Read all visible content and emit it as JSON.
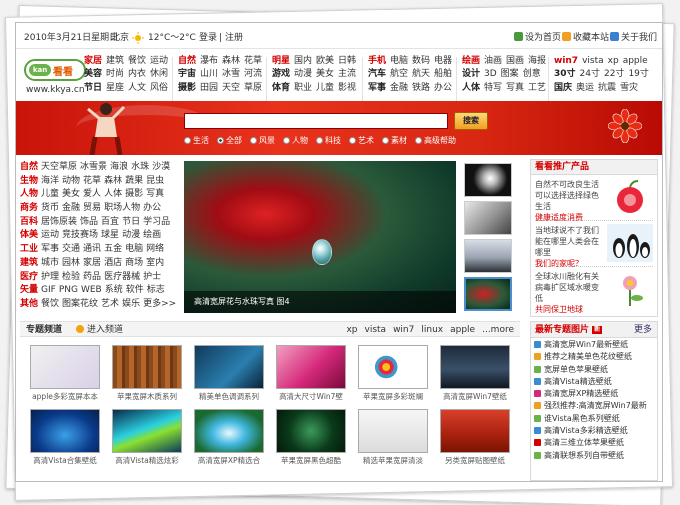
{
  "topbar": {
    "date": "2010年3月21日星期日",
    "city": "北京",
    "temperature": "12°C～2°C",
    "login": "登录",
    "divider": "|",
    "register": "注册",
    "set_home": "设为首页",
    "bookmark": "收藏本站",
    "about": "关于我们"
  },
  "logo": {
    "badge": "kan",
    "name": "看看",
    "url": "www.kkya.cn"
  },
  "nav_groups": [
    {
      "rows": [
        [
          "家居",
          "建筑",
          "餐饮",
          "运动"
        ],
        [
          "美容",
          "时尚",
          "内衣",
          "休闲"
        ],
        [
          "节日",
          "星座",
          "人文",
          "风俗"
        ]
      ]
    },
    {
      "rows": [
        [
          "自然",
          "瀑布",
          "森林",
          "花草"
        ],
        [
          "宇宙",
          "山川",
          "冰雪",
          "河流"
        ],
        [
          "摄影",
          "田园",
          "天空",
          "草原"
        ]
      ]
    },
    {
      "rows": [
        [
          "明星",
          "国内",
          "欧美",
          "日韩"
        ],
        [
          "游戏",
          "动漫",
          "美女",
          "主流"
        ],
        [
          "体育",
          "职业",
          "儿童",
          "影视"
        ]
      ]
    },
    {
      "rows": [
        [
          "手机",
          "电脑",
          "数码",
          "电器"
        ],
        [
          "汽车",
          "航空",
          "航天",
          "船舶"
        ],
        [
          "军事",
          "金融",
          "铁路",
          "办公"
        ]
      ]
    },
    {
      "rows": [
        [
          "绘画",
          "油画",
          "国画",
          "海报"
        ],
        [
          "设计",
          "3D",
          "图案",
          "创意"
        ],
        [
          "人体",
          "特写",
          "写真",
          "工艺"
        ]
      ]
    },
    {
      "rows": [
        [
          "win7",
          "vista",
          "xp",
          "apple"
        ],
        [
          "30寸",
          "24寸",
          "22寸",
          "19寸"
        ],
        [
          "国庆",
          "奥运",
          "抗震",
          "雪灾"
        ]
      ]
    }
  ],
  "search": {
    "button": "搜索",
    "options": [
      "生活",
      "全部",
      "风景",
      "人物",
      "科技",
      "艺术",
      "素材",
      "高级帮助"
    ],
    "selected": "全部"
  },
  "categories": [
    [
      "自然",
      "天空草原",
      "冰雪景",
      "海浪",
      "水珠",
      "沙漠"
    ],
    [
      "生物",
      "海洋",
      "动物",
      "花草",
      "森林",
      "蔬果",
      "昆虫"
    ],
    [
      "人物",
      "儿童",
      "美女",
      "爱人",
      "人体",
      "摄影",
      "写真"
    ],
    [
      "商务",
      "货币",
      "金融",
      "贸易",
      "职场人物",
      "办公"
    ],
    [
      "百科",
      "居饰原装",
      "饰品",
      "百宜",
      "节日",
      "学习品"
    ],
    [
      "体美",
      "运动",
      "竞技赛场",
      "球星",
      "动漫",
      "绘画"
    ],
    [
      "工业",
      "军事",
      "交通",
      "通讯",
      "五金",
      "电脑",
      "网络"
    ],
    [
      "建筑",
      "城市",
      "园林",
      "家居",
      "酒店",
      "商场",
      "室内"
    ],
    [
      "医疗",
      "护理",
      "检验",
      "药品",
      "医疗器械",
      "护士"
    ],
    [
      "矢量",
      "GIF",
      "PNG",
      "WEB",
      "系统",
      "软件",
      "标志"
    ],
    [
      "其他",
      "餐饮",
      "图案花纹",
      "艺术",
      "娱乐",
      "更多>>"
    ]
  ],
  "featured": {
    "caption": "高清宽屏花与水珠写真 图4"
  },
  "promo": {
    "title": "看看推广产品",
    "items": [
      {
        "text": "自然不可改良生活可以选择选择绿色生活",
        "highlight": "健康适度消费"
      },
      {
        "text": "当地球说不了我们能在哪里人类会在哪里",
        "highlight": "我们的家呢？"
      },
      {
        "text": "全球冰川融化有关病毒扩区域水暖变低",
        "highlight": "共同保卫地球"
      }
    ]
  },
  "special": {
    "title": "专题频道",
    "enter": "进入频道",
    "tags": [
      "xp",
      "vista",
      "win7",
      "linux",
      "apple",
      "...more"
    ]
  },
  "gallery": [
    "apple多彩宽屏本本",
    "苹果宽屏木质系列",
    "精美单色调调系列",
    "高清大尺寸Win7壁",
    "苹果宽屏多彩斑斓",
    "高清宽屏Win7壁纸",
    "高清Vista合集壁纸",
    "高清Vista精选炫彩",
    "高清宽屏XP精选合",
    "苹果宽屏黑色超酷",
    "精选苹果宽屏清淡",
    "另类宽屏贴图壁纸"
  ],
  "latest": {
    "title": "最新专题图片",
    "badge": "新",
    "more": "更多",
    "items": [
      "高清宽屏Win7最新壁纸",
      "推荐之精美单色花纹壁纸",
      "宽屏单色苹果壁纸",
      "高清Vista精选壁纸",
      "高清宽屏XP精选壁纸",
      "强烈推荐:高清宽屏Win7最新",
      "谁Vista黑色系列壁纸",
      "高清Vista多彩精选壁纸",
      "高清三维立体苹果壁纸",
      "高清联想系列自带壁纸"
    ]
  },
  "colors": {
    "accent": "#d40000",
    "banner": "#d92812",
    "button": "#f0a020"
  }
}
